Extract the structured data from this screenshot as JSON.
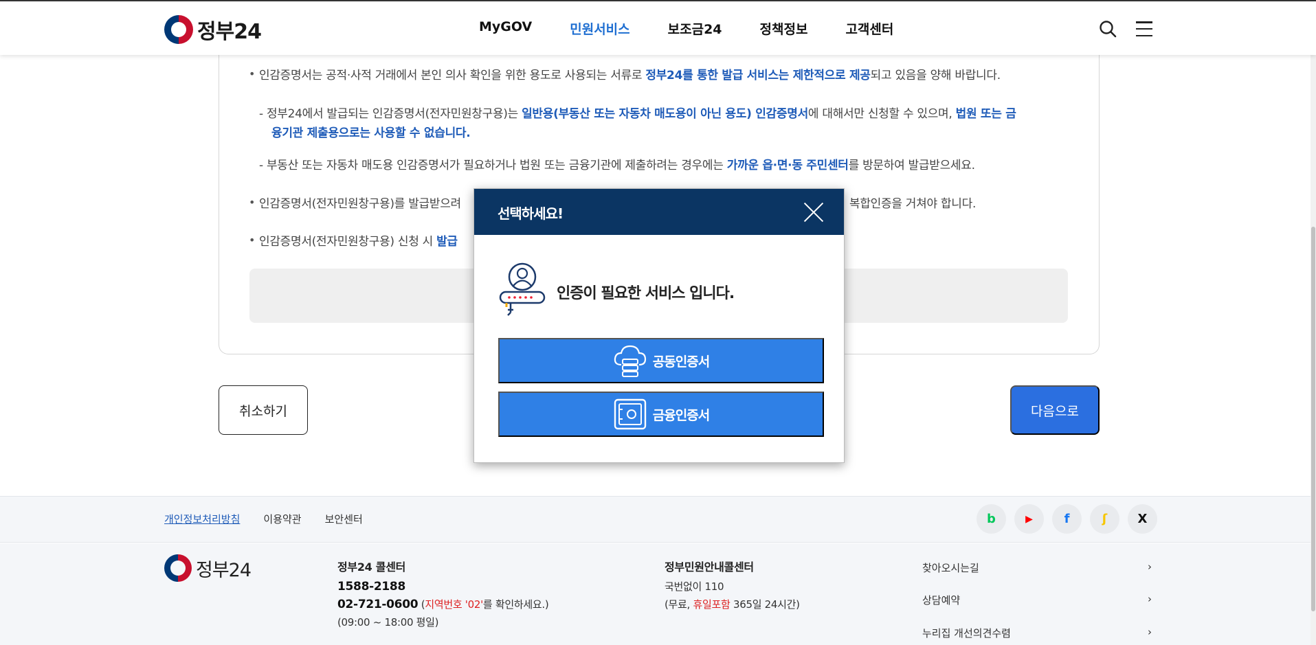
{
  "header": {
    "logo_text": "정부24",
    "nav": [
      {
        "label": "MyGOV",
        "active": false
      },
      {
        "label": "민원서비스",
        "active": true
      },
      {
        "label": "보조금24",
        "active": false
      },
      {
        "label": "정책정보",
        "active": false
      },
      {
        "label": "고객센터",
        "active": false
      }
    ],
    "search_icon": "search-icon",
    "menu_icon": "hamburger-menu-icon"
  },
  "notice": {
    "line1_a": "인감증명서는 공적·사적 거래에서 본인 의사 확인을 위한 용도로 사용되는 서류로 ",
    "line1_b": "정부24를 통한 발급 서비스는 제한적으로 제공",
    "line1_c": "되고 있음을 양해 바랍니다.",
    "line2_a": "- 정부24에서 발급되는 인감증명서(전자민원창구용)는 ",
    "line2_b": "일반용(부동산 또는 자동차 매도용이 아닌 용도) 인감증명서",
    "line2_c": "에 대해서만 신청할 수 있으며, ",
    "line2_d": "법원 또는 금",
    "line3": "융기관 제출용으로는 사용할 수 없습니다.",
    "line4_a": "- 부동산 또는 자동차 매도용 인감증명서가 필요하거나 법원 또는 금융기관에 제출하려는 경우에는 ",
    "line4_b": "가까운 읍·면·동 주민센터",
    "line4_c": "를 방문하여 발급받으세요.",
    "line5_a": "인감증명서(전자민원창구용)를 발급받으려",
    "line5_b": "복합인증을 거쳐야 합니다.",
    "line6_a": "인감증명서(전자민원창구용) 신청 시 ",
    "line6_b": "발급"
  },
  "buttons": {
    "cancel": "취소하기",
    "next": "다음으로"
  },
  "modal": {
    "title": "선택하세요!",
    "close_icon": "close-icon",
    "message": "인증이 필요한 서비스 입니다.",
    "options": [
      {
        "label": "공동인증서",
        "icon": "cloud-server-icon"
      },
      {
        "label": "금융인증서",
        "icon": "safe-icon"
      }
    ]
  },
  "footer": {
    "links": [
      "개인정보처리방침",
      "이용약관",
      "보안센터"
    ],
    "socials": [
      {
        "name": "blog-icon",
        "glyph": "b",
        "color": "#03c75a"
      },
      {
        "name": "youtube-icon",
        "glyph": "▶",
        "color": "#ff0000"
      },
      {
        "name": "facebook-icon",
        "glyph": "f",
        "color": "#1877f2"
      },
      {
        "name": "kakao-icon",
        "glyph": "ʃ",
        "color": "#f7c600"
      },
      {
        "name": "x-icon",
        "glyph": "X",
        "color": "#111111"
      }
    ],
    "logo_text": "정부24",
    "callcenter": {
      "title": "정부24 콜센터",
      "phone1": "1588-2188",
      "phone2": "02-721-0600",
      "note_open": " (",
      "note_red": "지역번호 '02'",
      "note_close": "를 확인하세요.)",
      "hours": "(09:00 ~ 18:00 평일)"
    },
    "minwon": {
      "title": "정부민원안내콜센터",
      "line1": "국번없이 110",
      "line2_a": "(무료, ",
      "line2_red": "휴일포함",
      "line2_b": " 365일 24시간)"
    },
    "quick_links": [
      "찾아오시는길",
      "상담예약",
      "누리집 개선의견수렴"
    ]
  }
}
